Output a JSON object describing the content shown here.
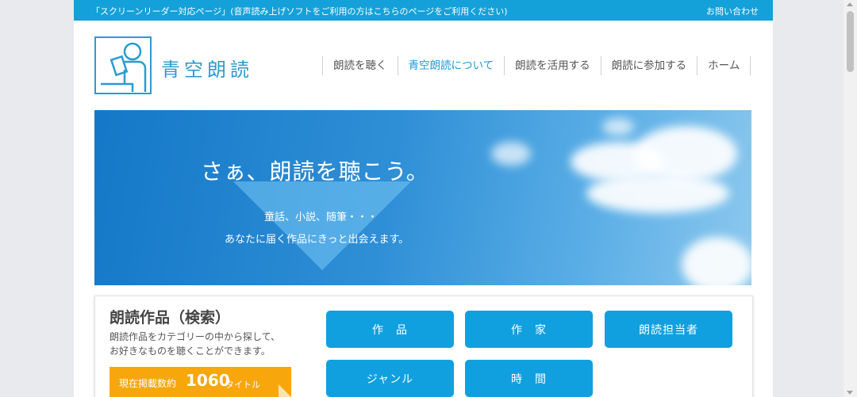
{
  "topbar": {
    "screen_reader_link": "「スクリーンリーダー対応ページ」(音声読み上げソフトをご利用の方はこちらのページをご利用ください)",
    "contact_link": "お問い合わせ"
  },
  "logo": {
    "title": "青空朗読",
    "icon": "reading-person-icon"
  },
  "nav": {
    "items": [
      {
        "label": "朗読を聴く"
      },
      {
        "label": "青空朗読について"
      },
      {
        "label": "朗読を活用する"
      },
      {
        "label": "朗読に参加する"
      },
      {
        "label": "ホーム"
      }
    ]
  },
  "hero": {
    "heading": "さぁ、朗読を聴こう。",
    "line1": "童話、小説、随筆・・・",
    "line2": "あなたに届く作品にきっと出会えます。"
  },
  "search": {
    "title": "朗読作品（検索）",
    "desc_line1": "朗読作品をカテゴリーの中から探して、",
    "desc_line2": "お好きなものを聴くことができます。",
    "count_label": "現在掲載数約",
    "count_value": "1060",
    "count_unit": "タイトル",
    "buttons": {
      "works": "作　品",
      "authors": "作　家",
      "readers": "朗読担当者",
      "genre": "ジャンル",
      "time": "時　間"
    }
  },
  "colors": {
    "accent": "#14a1d9",
    "badge": "#f7a70c",
    "button": "#11a0df"
  }
}
